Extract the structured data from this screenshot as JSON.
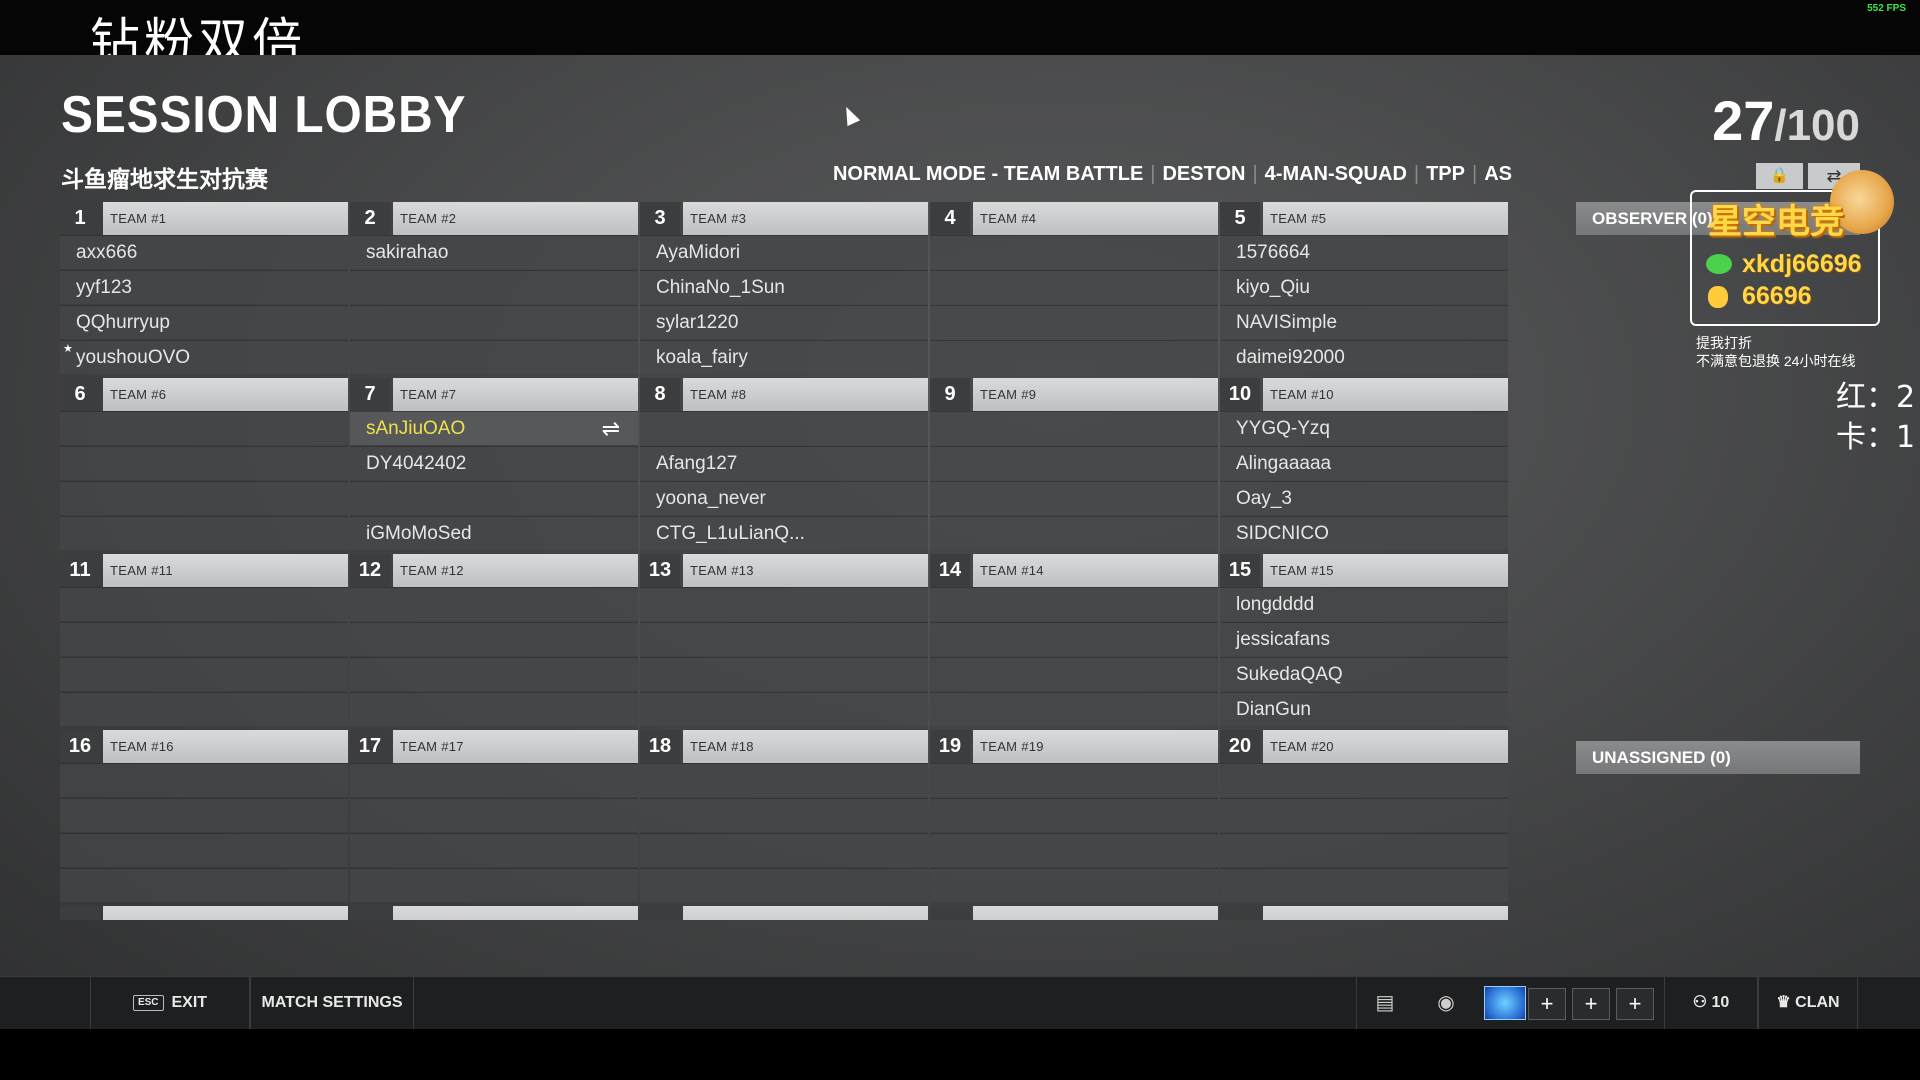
{
  "overlay": {
    "top_caption": "钻粉双倍",
    "fps": "552 FPS"
  },
  "lobby": {
    "title": "SESSION LOBBY",
    "subtitle": "斗鱼瘤地求生对抗赛",
    "player_count": "27",
    "player_max": "/100",
    "mode": [
      "NORMAL MODE - TEAM BATTLE",
      "DESTON",
      "4-MAN-SQUAD",
      "TPP",
      "AS"
    ]
  },
  "teams": [
    {
      "num": "1",
      "name": "TEAM #1",
      "slots": [
        "axx666",
        "yyf123",
        "QQhurryup",
        "youshouOVO"
      ]
    },
    {
      "num": "2",
      "name": "TEAM #2",
      "slots": [
        "sakirahao",
        "",
        "",
        ""
      ]
    },
    {
      "num": "3",
      "name": "TEAM #3",
      "slots": [
        "AyaMidori",
        "ChinaNo_1Sun",
        "sylar1220",
        "koala_fairy"
      ]
    },
    {
      "num": "4",
      "name": "TEAM #4",
      "slots": [
        "",
        "",
        "",
        ""
      ]
    },
    {
      "num": "5",
      "name": "TEAM #5",
      "slots": [
        "1576664",
        "kiyo_Qiu",
        "NAVISimple",
        "daimei92000"
      ]
    },
    {
      "num": "6",
      "name": "TEAM #6",
      "slots": [
        "",
        "",
        "",
        ""
      ]
    },
    {
      "num": "7",
      "name": "TEAM #7",
      "slots": [
        "sAnJiuOAO",
        "DY4042402",
        "",
        "iGMoMoSed"
      ]
    },
    {
      "num": "8",
      "name": "TEAM #8",
      "slots": [
        "",
        "Afang127",
        "yoona_never",
        "CTG_L1uLianQ..."
      ]
    },
    {
      "num": "9",
      "name": "TEAM #9",
      "slots": [
        "",
        "",
        "",
        ""
      ]
    },
    {
      "num": "10",
      "name": "TEAM #10",
      "slots": [
        "YYGQ-Yzq",
        "Alingaaaaa",
        "Oay_3",
        "SIDCNICO"
      ]
    },
    {
      "num": "11",
      "name": "TEAM #11",
      "slots": [
        "",
        "",
        "",
        ""
      ]
    },
    {
      "num": "12",
      "name": "TEAM #12",
      "slots": [
        "",
        "",
        "",
        ""
      ]
    },
    {
      "num": "13",
      "name": "TEAM #13",
      "slots": [
        "",
        "",
        "",
        ""
      ]
    },
    {
      "num": "14",
      "name": "TEAM #14",
      "slots": [
        "",
        "",
        "",
        ""
      ]
    },
    {
      "num": "15",
      "name": "TEAM #15",
      "slots": [
        "longdddd",
        "jessicafans",
        "SukedaQAQ",
        "DianGun"
      ]
    },
    {
      "num": "16",
      "name": "TEAM #16",
      "slots": [
        "",
        "",
        "",
        ""
      ]
    },
    {
      "num": "17",
      "name": "TEAM #17",
      "slots": [
        "",
        "",
        "",
        ""
      ]
    },
    {
      "num": "18",
      "name": "TEAM #18",
      "slots": [
        "",
        "",
        "",
        ""
      ]
    },
    {
      "num": "19",
      "name": "TEAM #19",
      "slots": [
        "",
        "",
        "",
        ""
      ]
    },
    {
      "num": "20",
      "name": "TEAM #20",
      "slots": [
        "",
        "",
        "",
        ""
      ]
    },
    {
      "num": "",
      "name": "",
      "slots": [
        "",
        "",
        "",
        ""
      ]
    },
    {
      "num": "",
      "name": "",
      "slots": [
        "",
        "",
        "",
        ""
      ]
    },
    {
      "num": "",
      "name": "",
      "slots": [
        "",
        "",
        "",
        ""
      ]
    },
    {
      "num": "",
      "name": "",
      "slots": [
        "",
        "",
        "",
        ""
      ]
    },
    {
      "num": "",
      "name": "",
      "slots": [
        "",
        "",
        "",
        ""
      ]
    }
  ],
  "current_player": {
    "team_index": 6,
    "slot_index": 0
  },
  "starred_player": {
    "team_index": 0,
    "slot_index": 3
  },
  "side": {
    "observer_label": "OBSERVER (0)",
    "unassigned_label": "UNASSIGNED (0)"
  },
  "streamer": {
    "name": "星空电竞",
    "wechat": "xkdj66696",
    "qq": "66696",
    "note_line1": "提我打折",
    "note_line2": "不满意包退换 24小时在线",
    "score_red": "红：2",
    "score_card": "卡：1"
  },
  "bottom": {
    "esc_key": "ESC",
    "exit_label": "EXIT",
    "match_settings_label": "MATCH SETTINGS",
    "friends_count": "10",
    "clan_label": "CLAN"
  },
  "icons": {
    "lock": "lock-icon",
    "menu": "swap-icon",
    "chat": "chat-icon",
    "settings": "badge-icon",
    "friends": "friends-icon",
    "clan": "clan-icon"
  }
}
